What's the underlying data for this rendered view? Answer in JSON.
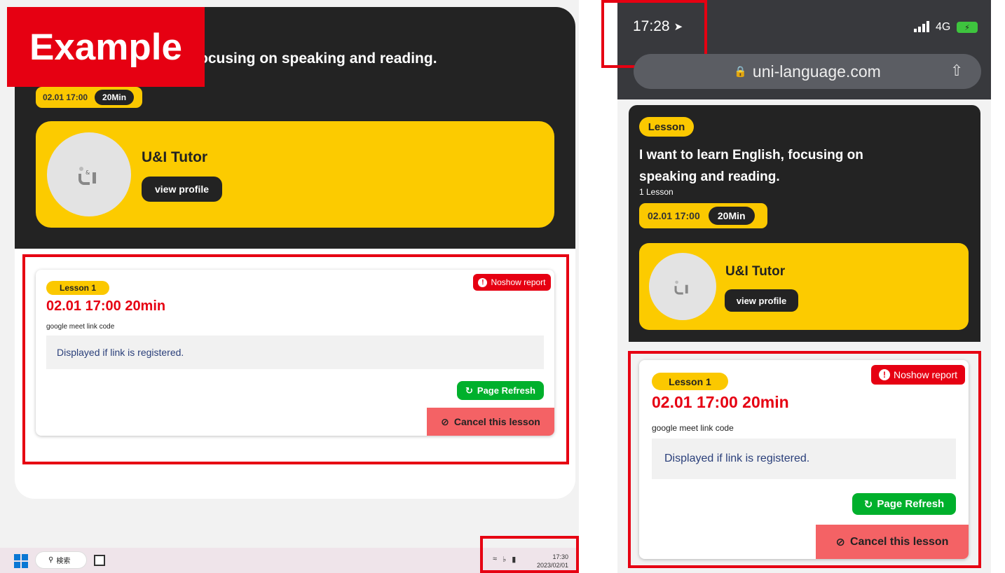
{
  "example_label": "Example",
  "desktop": {
    "title_fragment": "ocusing on speaking and reading.",
    "date": "02.01 17:00",
    "duration": "20Min",
    "tutor": {
      "name": "U&I Tutor",
      "profile_button": "view profile",
      "avatar_icon": "u-and-i-logo-icon"
    },
    "lesson": {
      "badge": "Lesson 1",
      "datetime": "02.01 17:00 20min",
      "noshow_button": "Noshow report",
      "meet_label": "google meet link code",
      "link_placeholder": "Displayed if link is registered.",
      "refresh_button": "Page Refresh",
      "cancel_button": "Cancel this lesson"
    },
    "taskbar": {
      "search_label": "検索",
      "time": "17:30",
      "date": "2023/02/01"
    }
  },
  "mobile": {
    "status_time": "17:28",
    "network": "4G",
    "url": "uni-language.com",
    "badge": "Lesson",
    "title_line1": "I want to learn English, focusing on",
    "title_line2": "speaking and reading.",
    "lesson_count": "1 Lesson",
    "date": "02.01 17:00",
    "duration": "20Min",
    "tutor": {
      "name": "U&I Tutor",
      "profile_button": "view profile"
    },
    "lesson": {
      "badge": "Lesson 1",
      "datetime": "02.01 17:00 20min",
      "noshow_button": "Noshow report",
      "meet_label": "google meet link code",
      "link_placeholder": "Displayed if link is registered.",
      "refresh_button": "Page Refresh",
      "cancel_button": "Cancel this lesson"
    }
  },
  "colors": {
    "accent_yellow": "#fccb00",
    "dark": "#232323",
    "alert_red": "#e60012",
    "refresh_green": "#00b02c",
    "cancel_red": "#f46265"
  }
}
